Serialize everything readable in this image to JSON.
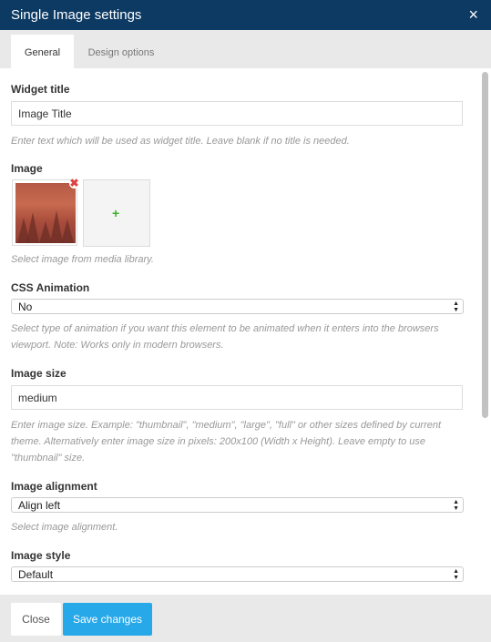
{
  "window": {
    "title": "Single Image settings",
    "close_glyph": "×"
  },
  "tabs": [
    {
      "label": "General",
      "active": true
    },
    {
      "label": "Design options",
      "active": false
    }
  ],
  "fields": {
    "widget_title": {
      "label": "Widget title",
      "value": "Image Title",
      "help": "Enter text which will be used as widget title. Leave blank if no title is needed."
    },
    "image": {
      "label": "Image",
      "help": "Select image from media library."
    },
    "css_animation": {
      "label": "CSS Animation",
      "value": "No",
      "help": "Select type of animation if you want this element to be animated when it enters into the browsers viewport. Note: Works only in modern browsers."
    },
    "image_size": {
      "label": "Image size",
      "value": "medium",
      "help": "Enter image size. Example: \"thumbnail\", \"medium\", \"large\", \"full\" or other sizes defined by current theme. Alternatively enter image size in pixels: 200x100 (Width x Height). Leave empty to use \"thumbnail\" size."
    },
    "image_alignment": {
      "label": "Image alignment",
      "value": "Align left",
      "help": "Select image alignment."
    },
    "image_style": {
      "label": "Image style",
      "value": "Default"
    }
  },
  "footer": {
    "close_label": "Close",
    "save_label": "Save changes"
  },
  "colors": {
    "titlebar": "#0d3a63",
    "primary_button": "#26a8e9",
    "remove_icon": "#e04040",
    "add_icon": "#3cb22c"
  },
  "icons": {
    "close": "close-icon",
    "remove": "remove-image-icon",
    "add": "plus-icon",
    "select": "updown-arrows-icon"
  }
}
